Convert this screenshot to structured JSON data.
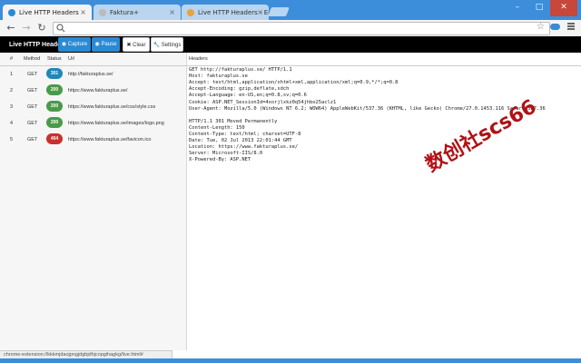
{
  "browser": {
    "tabs": [
      {
        "title": "Live HTTP Headers",
        "active": true,
        "favicon_color": "#2a8ad3"
      },
      {
        "title": "Faktura+",
        "active": false,
        "favicon_color": "#bbbbbb"
      },
      {
        "title": "Live HTTP Headers - Edit",
        "active": false,
        "favicon_color": "#e8a33a"
      }
    ],
    "tab_close": "×",
    "window_controls": {
      "minimize": "–",
      "maximize": "□",
      "close": "✕"
    },
    "nav": {
      "back": "←",
      "forward": "→",
      "reload": "↻"
    },
    "address_value": "",
    "star": "☆"
  },
  "app": {
    "title": "Live HTTP Headers",
    "buttons": {
      "capture": "Capture",
      "pause": "Pause",
      "clear": "Clear",
      "settings": "Settings"
    },
    "colors": {
      "bar": "#000000",
      "blue": "#2a8ad3",
      "badge301": "#1e88b8",
      "badge200": "#4a9a4a",
      "badge404": "#c9302c"
    }
  },
  "table": {
    "headers": {
      "num": "#",
      "method": "Method",
      "status": "Status",
      "url": "Url"
    },
    "rows": [
      {
        "num": "1",
        "method": "GET",
        "status": "301",
        "url": "http://fakturaplus.se/"
      },
      {
        "num": "2",
        "method": "GET",
        "status": "200",
        "url": "https://www.fakturaplus.se/"
      },
      {
        "num": "3",
        "method": "GET",
        "status": "200",
        "url": "https://www.fakturaplus.se/css/style.css"
      },
      {
        "num": "4",
        "method": "GET",
        "status": "200",
        "url": "https://www.fakturaplus.se/images/logo.png"
      },
      {
        "num": "5",
        "method": "GET",
        "status": "404",
        "url": "https://www.fakturaplus.se/favicon.ico"
      }
    ]
  },
  "headers_panel": {
    "title": "Headers",
    "lines": [
      "GET http://fakturaplus.se/ HTTP/1.1",
      "Host: fakturaplus.se",
      "Accept: text/html,application/xhtml+xml,application/xml;q=0.9,*/*;q=0.8",
      "Accept-Encoding: gzip,deflate,sdch",
      "Accept-Language: en-US,en;q=0.8,sv;q=0.6",
      "Cookie: ASP.NET_SessionId=4xorjlxkz0q54jhbo25aclz1",
      "User-Agent: Mozilla/5.0 (Windows NT 6.2; WOW64) AppleWebKit/537.36 (KHTML, like Gecko) Chrome/27.0.1453.116 Safari/537.36",
      "",
      "HTTP/1.1 301 Moved Permanently",
      "Content-Length: 150",
      "Content-Type: text/html; charset=UTF-8",
      "Date: Tue, 02 Jul 2013 22:01:44 GMT",
      "Location: https://www.fakturaplus.se/",
      "Server: Microsoft-IIS/8.0",
      "X-Powered-By: ASP.NET"
    ]
  },
  "watermark": "数创社scs66",
  "status_bar": "chrome-extension://kkkmjdaojpngjdgbjdhjcopgihagkg/live.html#"
}
